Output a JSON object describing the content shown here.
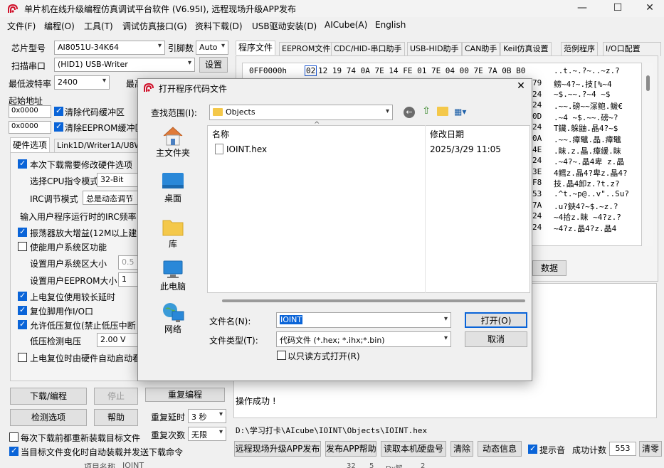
{
  "window": {
    "title": "单片机在线升级编程仿真调试平台软件 (V6.95I), 远程现场升级APP发布",
    "min": "—",
    "max": "☐",
    "close": "✕"
  },
  "menu": [
    "文件(F)",
    "编程(O)",
    "工具(T)",
    "调试仿真接口(G)",
    "资料下载(D)",
    "USB驱动安装(D)",
    "AICube(A)",
    "English"
  ],
  "left": {
    "chip_label": "芯片型号",
    "chip_value": "AI8051U-34K64",
    "pin_label": "引脚数",
    "pin_value": "Auto",
    "port_label": "扫描串口",
    "port_value": "(HID1) USB-Writer",
    "settings_btn": "设置",
    "baud_label": "最低波特率",
    "baud_value": "2400",
    "max_label": "最高",
    "start_label": "起始地址",
    "addr1": "0x0000",
    "clear_code": "清除代码缓冲区",
    "addr2": "0x0000",
    "clear_eeprom": "清除EEPROM缓冲区",
    "tabs": [
      "硬件选项",
      "Link1D/Writer1A/U8W"
    ],
    "options": [
      {
        "label": "本次下载需要修改硬件选项",
        "checked": true
      },
      {
        "label": "选择CPU指令模式",
        "value": "32-Bit"
      },
      {
        "label": "IRC调节模式",
        "value": "总是动态调节"
      },
      {
        "label": "输入用户程序运行时的IRC频率"
      },
      {
        "label": "振荡器放大增益(12M以上建议",
        "checked": true
      },
      {
        "label": "使能用户系统区功能",
        "checked": false
      },
      {
        "label": "设置用户系统区大小",
        "value": "0.5"
      },
      {
        "label": "设置用户EEPROM大小",
        "value": "1"
      },
      {
        "label": "上电复位使用较长延时",
        "checked": true
      },
      {
        "label": "复位脚用作I/O口",
        "checked": true
      },
      {
        "label": "允许低压复位(禁止低压中断",
        "checked": true
      },
      {
        "label": "低压检测电压",
        "value": "2.00 V"
      },
      {
        "label": "上电复位时由硬件自动启动看",
        "checked": false
      }
    ],
    "download_btn": "下载/编程",
    "stop_btn": "停止",
    "reprogram_btn": "重复编程",
    "detect_btn": "检测选项",
    "help_btn": "帮助",
    "repeat_delay_label": "重复延时",
    "repeat_delay_value": "3 秒",
    "reload_label": "每次下载前都重新装载目标文件",
    "repeat_count_label": "重复次数",
    "repeat_count_value": "无限",
    "auto_label": "当目标文件变化时自动装载并发送下载命令"
  },
  "right": {
    "tabs": [
      "程序文件",
      "EEPROM文件",
      "CDC/HID-串口助手",
      "USB-HID助手",
      "CAN助手",
      "Keil仿真设置",
      "范例程序",
      "I/O口配置"
    ],
    "hex_addr": "0FF0000h",
    "hex_first": "02",
    "hex_bytes": "12 19 74 0A 7E 14 FE 01 7E 04 00 7E 7A 0B B0",
    "hex_ascii_first": "..t.~.?~..~z.?",
    "hex_right": [
      {
        "hex": "79",
        "ascii": "鳑~4?~.技[%~4"
      },
      {
        "hex": "24",
        "ascii": "~$.~~.?~4  ~$"
      },
      {
        "hex": "24",
        "ascii": ".~~.磅~~溕鲍.鲅€"
      },
      {
        "hex": "0D",
        "ascii": ".~4  ~$.~~.磅~?"
      },
      {
        "hex": "24",
        "ascii": "T鑶.躲鼬.晶4?~$"
      },
      {
        "hex": "0A",
        "ascii": ".~~.瘴鼊.晶.瘴鼊"
      },
      {
        "hex": "4E",
        "ascii": ".眜.z.晶.瘴緩.眜"
      },
      {
        "hex": "24",
        "ascii": ".~4?~.晶4卑 z.晶"
      },
      {
        "hex": "3E",
        "ascii": "4鳕z.晶4?卑z.晶4?"
      },
      {
        "hex": "F8",
        "ascii": "技.晶4卸z.?t.z?"
      },
      {
        "hex": "53",
        "ascii": ".^t.~p@..v\"..Su?"
      },
      {
        "hex": "7A",
        "ascii": ".u?鋏4?~$.~z.?"
      },
      {
        "hex": "24",
        "ascii": "~4拾z.眜  ~4?z.?"
      },
      {
        "hex": "24",
        "ascii": "~4?z.晶4?z.晶4"
      }
    ],
    "data_btn": "数据",
    "status": "操作成功 !",
    "path": "D:\\学习打卡\\AIcube\\IOINT\\Objects\\IOINT.hex",
    "bottom_buttons": [
      "远程现场升级APP发布",
      "发布APP帮助",
      "读取本机硬盘号",
      "清除",
      "动态信息"
    ],
    "beep_label": "提示音",
    "count_label": "成功计数",
    "count_value": "553",
    "clear_btn": "清零",
    "bottom_peek": [
      "项目名称",
      "IOINT",
      "32",
      "5",
      "Dx解",
      "2"
    ]
  },
  "dialog": {
    "title": "打开程序代码文件",
    "close": "✕",
    "lookin_label": "查找范围(I):",
    "lookin_value": "Objects",
    "nav": [
      "主文件夹",
      "桌面",
      "库",
      "此电脑",
      "网络"
    ],
    "col_name": "名称",
    "col_date": "修改日期",
    "files": [
      {
        "name": "IOINT.hex",
        "date": "2025/3/29 11:05"
      }
    ],
    "filename_label": "文件名(N):",
    "filename_value": "IOINT",
    "filetype_label": "文件类型(T):",
    "filetype_value": "代码文件 (*.hex;  *.ihx;*.bin)",
    "open_btn": "打开(O)",
    "cancel_btn": "取消",
    "readonly_label": "以只读方式打开(R)"
  }
}
